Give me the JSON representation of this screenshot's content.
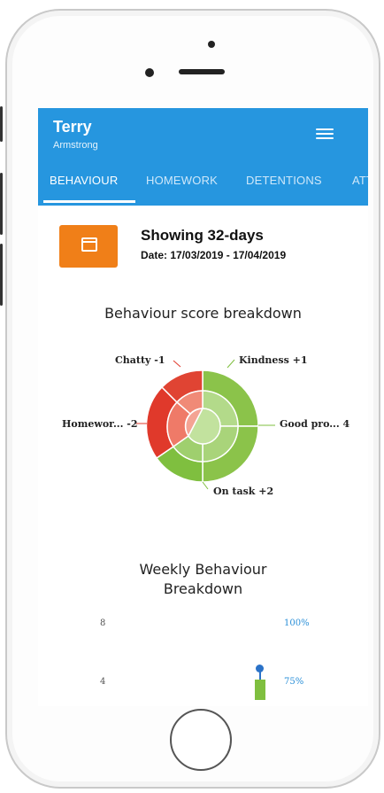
{
  "user": {
    "first_name": "Terry",
    "last_name": "Armstrong"
  },
  "tabs": [
    {
      "label": "BEHAVIOUR",
      "active": true
    },
    {
      "label": "HOMEWORK",
      "active": false
    },
    {
      "label": "DETENTIONS",
      "active": false
    },
    {
      "label": "ATT",
      "active": false
    }
  ],
  "date_filter": {
    "showing": "Showing 32-days",
    "range": "Date: 17/03/2019 - 17/04/2019"
  },
  "behaviour_breakdown": {
    "title": "Behaviour score breakdown",
    "labels": {
      "chatty": "Chatty -1",
      "kindness": "Kindness +1",
      "homework": "Homewor... -2",
      "good_progress": "Good pro... 4",
      "on_task": "On task +2"
    }
  },
  "weekly": {
    "title_line1": "Weekly Behaviour",
    "title_line2": "Breakdown",
    "left_axis": [
      "8",
      "4"
    ],
    "right_axis": [
      "100%",
      "75%"
    ]
  },
  "colors": {
    "appbar": "#2696df",
    "accent_orange": "#f07f18",
    "positive_green": "#7fbf3f",
    "negative_red": "#e0392b",
    "percent_blue": "#2a8fd8"
  },
  "chart_data": [
    {
      "type": "pie",
      "title": "Behaviour score breakdown",
      "categories": [
        "Kindness",
        "Good pro...",
        "On task",
        "Homewor...",
        "Chatty"
      ],
      "values": [
        1,
        4,
        2,
        -2,
        -1
      ]
    },
    {
      "type": "bar",
      "title": "Weekly Behaviour Breakdown",
      "left_ticks": [
        8,
        4
      ],
      "right_ticks": [
        "100%",
        "75%"
      ]
    }
  ]
}
